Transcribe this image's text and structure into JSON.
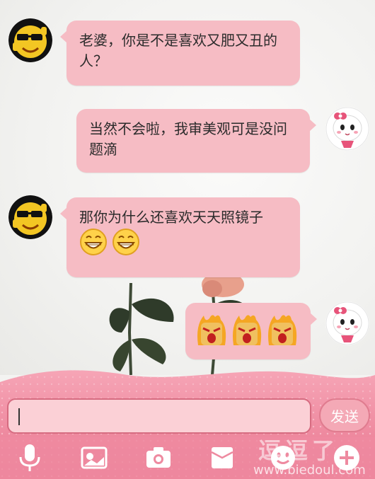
{
  "messages": [
    {
      "side": "left",
      "avatar": "sunglasses-emoji-avatar",
      "text": "老婆，你是不是喜欢又肥又丑的人？"
    },
    {
      "side": "right",
      "avatar": "cute-girl-avatar",
      "text": "当然不会啦，我审美观可是没问题滴"
    },
    {
      "side": "left",
      "avatar": "sunglasses-emoji-avatar",
      "text": "那你为什么还喜欢天天照镜子",
      "emojis": [
        "grin-emoji",
        "grin-emoji"
      ]
    },
    {
      "side": "right",
      "avatar": "cute-girl-avatar",
      "emojis": [
        "angry-flame-emoji",
        "angry-flame-emoji",
        "angry-flame-emoji"
      ]
    }
  ],
  "composer": {
    "input_value": "",
    "send_label": "发送",
    "tools": [
      "microphone-icon",
      "photo-album-icon",
      "camera-icon",
      "card-icon",
      "smiley-icon",
      "add-icon"
    ]
  },
  "watermark": {
    "text": "逗逗了",
    "url": "www.biedoul.com"
  },
  "colors": {
    "bubble": "#f6bcc4",
    "composer": "#ef8aa0",
    "input": "#fbd0d6",
    "send": "#f4a9b6"
  }
}
